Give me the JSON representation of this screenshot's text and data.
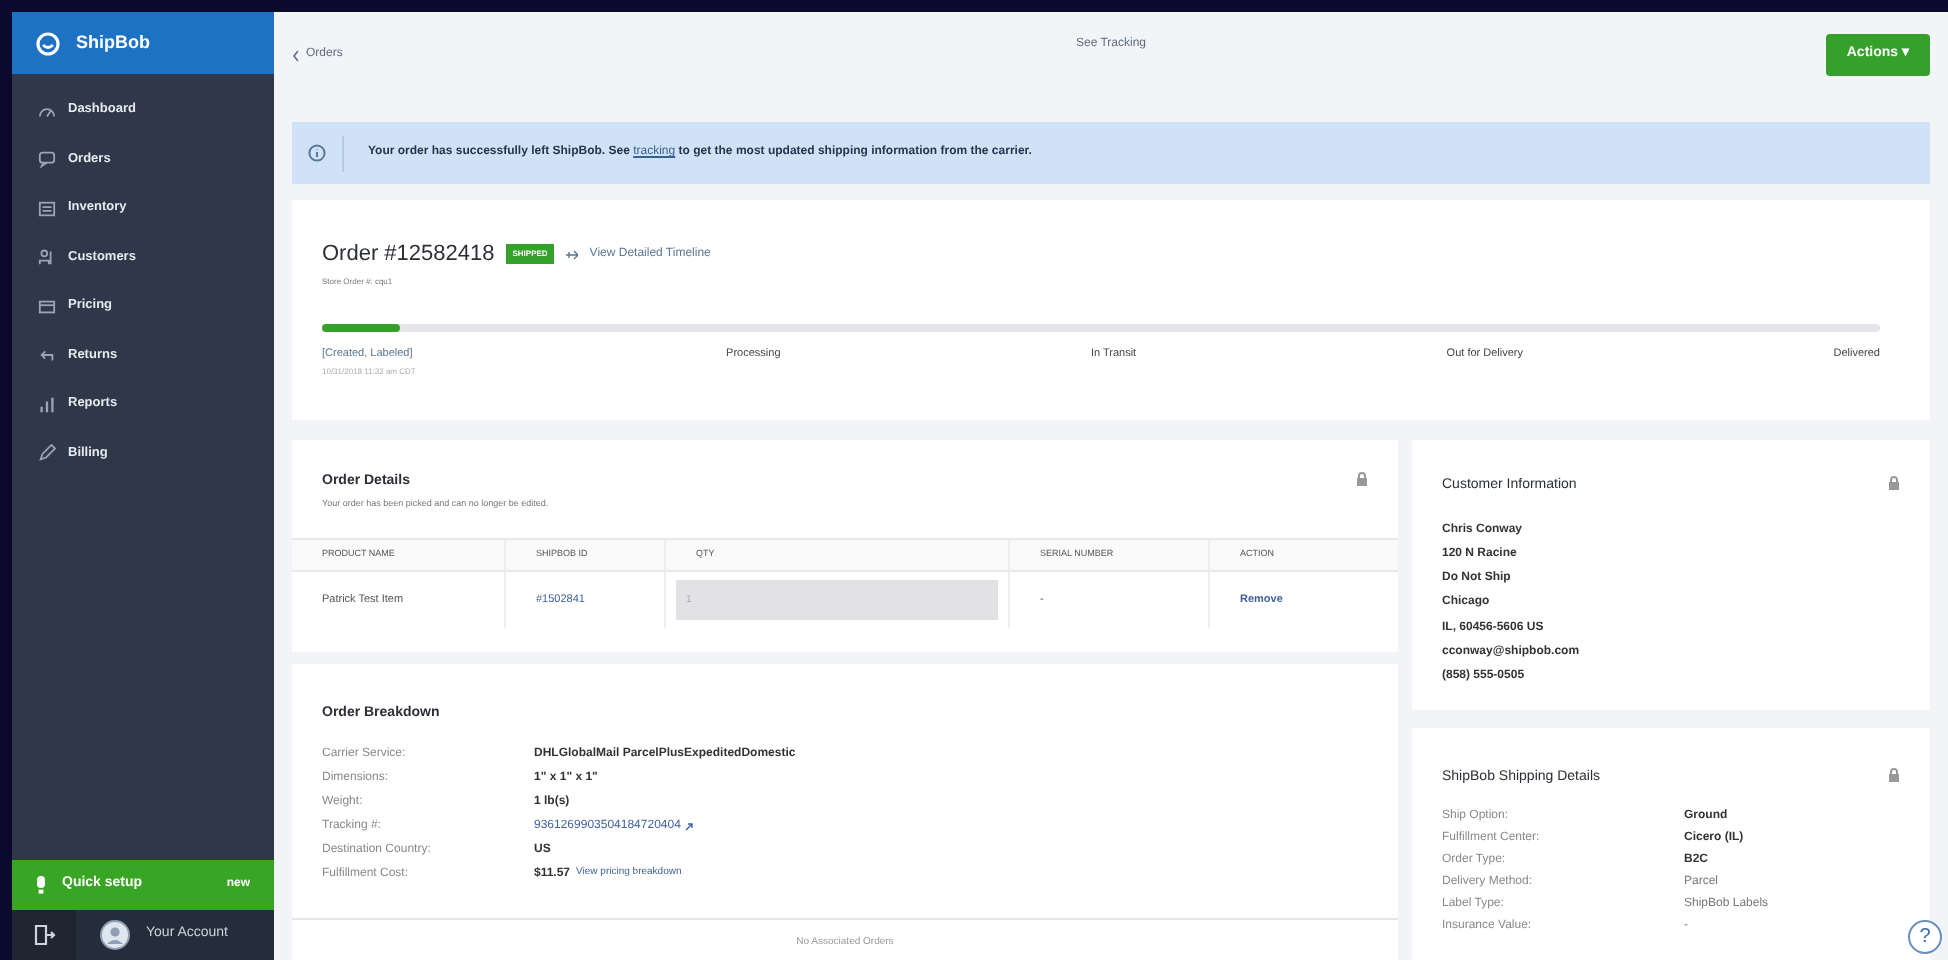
{
  "sidebar": {
    "brand": "ShipBob",
    "items": [
      {
        "label": "Dashboard",
        "selected": false
      },
      {
        "label": "Orders",
        "selected": false
      },
      {
        "label": "Inventory",
        "selected": false
      },
      {
        "label": "Customers",
        "selected": false
      },
      {
        "label": "Pricing",
        "selected": false
      },
      {
        "label": "Returns",
        "selected": false
      },
      {
        "label": "Reports",
        "selected": false
      },
      {
        "label": "Billing",
        "selected": false
      }
    ],
    "quick_setup": {
      "label": "Quick setup",
      "badge": "new"
    },
    "account": "Your Account"
  },
  "header": {
    "back": "Orders",
    "tracking": "See Tracking",
    "actions": "Actions ▾"
  },
  "banner": {
    "text": "Your order has successfully left ShipBob. See",
    "link": "tracking",
    "rest": "to get the most updated shipping information from the carrier."
  },
  "order": {
    "title": "Order #12582418",
    "status": "SHIPPED",
    "timeline": "View Detailed Timeline",
    "store_order": "Store Order #: cqu1",
    "level": 0.05,
    "steps": [
      {
        "label": "[Created, Labeled]",
        "date": "10/31/2018 11:32 am CDT",
        "done": true
      },
      {
        "label": "Processing",
        "done": false
      },
      {
        "label": "In Transit",
        "done": false
      },
      {
        "label": "Out for Delivery",
        "done": false
      },
      {
        "label": "Delivered",
        "done": false
      }
    ]
  },
  "order_details": {
    "title": "Order Details",
    "subtitle": "Your order has been picked and can no longer be edited.",
    "columns": [
      "PRODUCT NAME",
      "SHIPBOB ID",
      "QTY",
      "SERIAL NUMBER",
      "ACTION"
    ],
    "rows": [
      {
        "product": "Patrick Test Item",
        "shipbob_id": "#1502841",
        "qty": "1",
        "serial": "-",
        "action": "Remove"
      }
    ]
  },
  "order_breakdown": {
    "title": "Order Breakdown",
    "rows": [
      {
        "label": "Carrier Service:",
        "value": "DHLGlobalMail ParcelPlusExpeditedDomestic",
        "kind": "bold"
      },
      {
        "label": "Dimensions:",
        "value": "1\" x 1\" x 1\"",
        "kind": "bold"
      },
      {
        "label": "Weight:",
        "value": "1 lb(s)",
        "kind": "bold"
      },
      {
        "label": "Tracking #:",
        "value": "9361269903504184720404",
        "kind": "link"
      },
      {
        "label": "Destination Country:",
        "value": "US",
        "kind": "bold"
      },
      {
        "label": "Fulfillment Cost:",
        "value": "$11.57",
        "link": "View pricing breakdown",
        "kind": "cost"
      }
    ],
    "footer": "No Associated Orders"
  },
  "customer_information": {
    "title": "Customer Information",
    "lines": [
      "Chris Conway",
      "120 N Racine",
      "Do Not Ship",
      "Chicago",
      "IL, 60456-5606 US",
      "cconway@shipbob.com",
      "(858) 555-0505"
    ]
  },
  "shipping_details": {
    "title": "ShipBob Shipping Details",
    "rows": [
      {
        "label": "Ship Option:",
        "value": "Ground",
        "kind": "bold"
      },
      {
        "label": "Fulfillment Center:",
        "value": "Cicero (IL)",
        "kind": "bold"
      },
      {
        "label": "Order Type:",
        "value": "B2C",
        "kind": "bold"
      },
      {
        "label": "Delivery Method:",
        "value": "Parcel",
        "kind": "plain"
      },
      {
        "label": "Label Type:",
        "value": "ShipBob Labels",
        "kind": "plain"
      },
      {
        "label": "Insurance Value:",
        "value": "-",
        "kind": "plain"
      }
    ]
  },
  "help": "?"
}
